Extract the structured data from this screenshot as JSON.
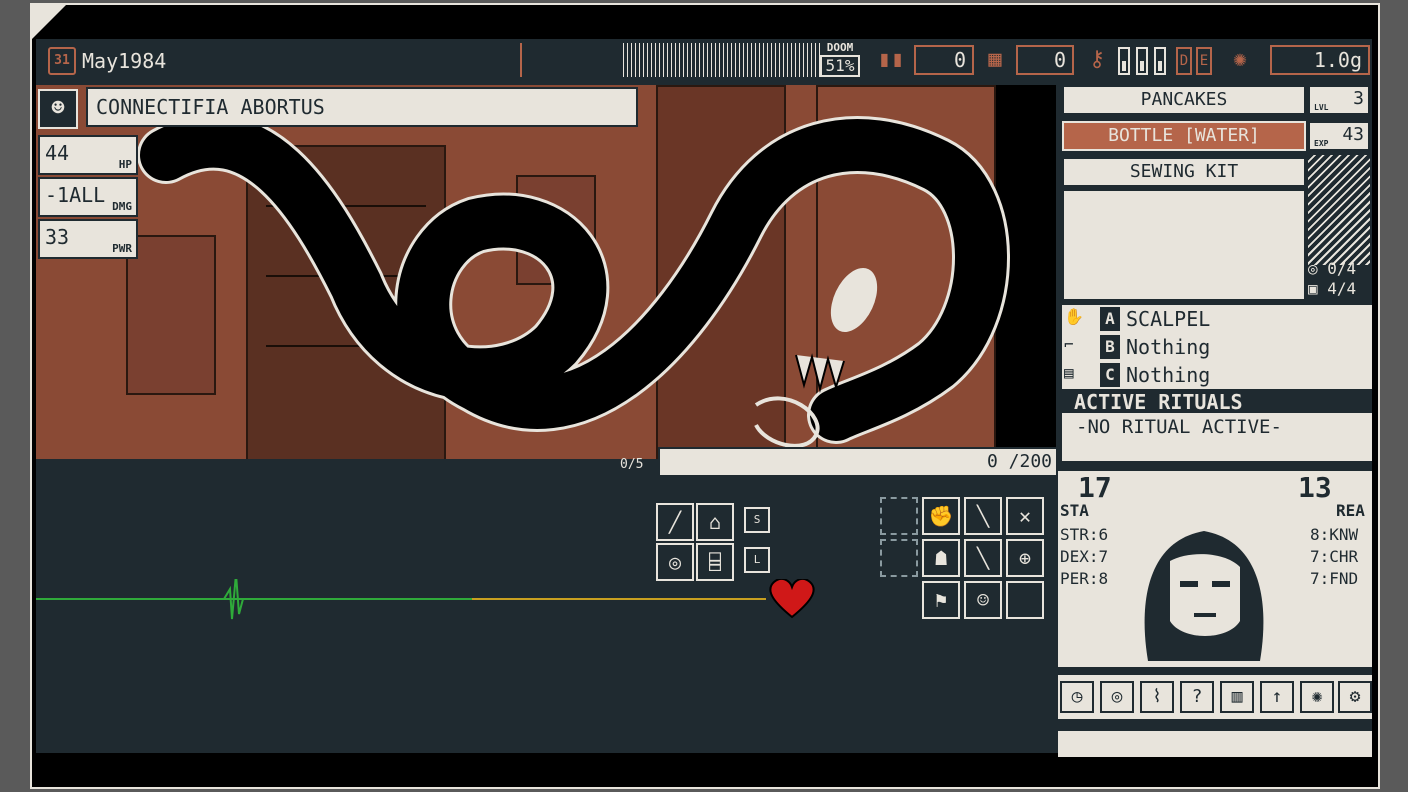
{
  "top": {
    "date": "May1984",
    "calendar_day": "31",
    "doom_label": "DOOM",
    "doom_value": "51%",
    "ammo_count": "0",
    "funds_count": "0",
    "weight": "1.0g",
    "rune_d": "D",
    "rune_e": "E"
  },
  "enemy": {
    "name": "CONNECTIFIA ABORTUS",
    "hp_value": "44",
    "hp_label": "HP",
    "dmg_value": "-1ALL",
    "dmg_label": "DMG",
    "pwr_value": "33",
    "pwr_label": "PWR",
    "bar_text": "0 /200",
    "counter": "0/5"
  },
  "inventory": {
    "items": [
      "PANCAKES",
      "BOTTLE [WATER]",
      "SEWING KIT"
    ],
    "selected_index": 1,
    "lvl_label": "LVL",
    "lvl_value": "3",
    "exp_label": "EXP",
    "exp_value": "43",
    "spell_count": "0/4",
    "bag_count": "4/4"
  },
  "weapons": [
    {
      "key": "A",
      "name": "SCALPEL",
      "icon": "hand-icon"
    },
    {
      "key": "B",
      "name": "Nothing",
      "icon": "gun-icon"
    },
    {
      "key": "C",
      "name": "Nothing",
      "icon": "book-icon"
    }
  ],
  "rituals": {
    "header": "ACTIVE RITUALS",
    "body": "-NO RITUAL ACTIVE-"
  },
  "character": {
    "sta_value": "17",
    "sta_label": "STA",
    "rea_value": "13",
    "rea_label": "REA",
    "str": "STR:6",
    "dex": "DEX:7",
    "per": "PER:8",
    "knw": "8:KNW",
    "chr": "7:CHR",
    "fnd": "7:FND"
  },
  "colors": {
    "bg": "#1f2a30",
    "cream": "#e8e4dc",
    "rust": "#b5654a",
    "wave_green": "#2faa3a",
    "wave_yellow": "#c8a020",
    "heart": "#d01818"
  }
}
